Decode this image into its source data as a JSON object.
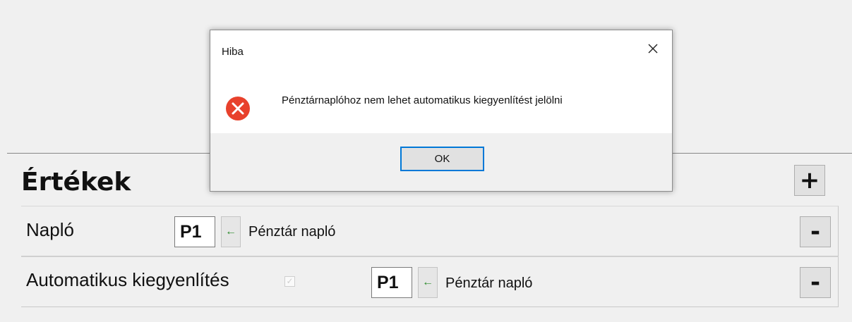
{
  "section": {
    "title": "Értékek",
    "add_label": "+"
  },
  "rows": [
    {
      "label": "Napló",
      "code": "P1",
      "link_text": "Pénztár napló",
      "remove_label": "-"
    },
    {
      "label": "Automatikus kiegyenlítés",
      "checked": true,
      "code": "P1",
      "link_text": "Pénztár napló",
      "remove_label": "-"
    }
  ],
  "dialog": {
    "title": "Hiba",
    "message": "Pénztárnaplóhoz nem lehet automatikus kiegyenlítést jelölni",
    "ok_label": "OK",
    "icon": "error-icon",
    "error_color": "#e8412c",
    "focus_color": "#0078d7"
  },
  "icons": {
    "close": "close-icon",
    "arrow": "left-arrow-icon",
    "checkbox": "checkbox-icon"
  }
}
